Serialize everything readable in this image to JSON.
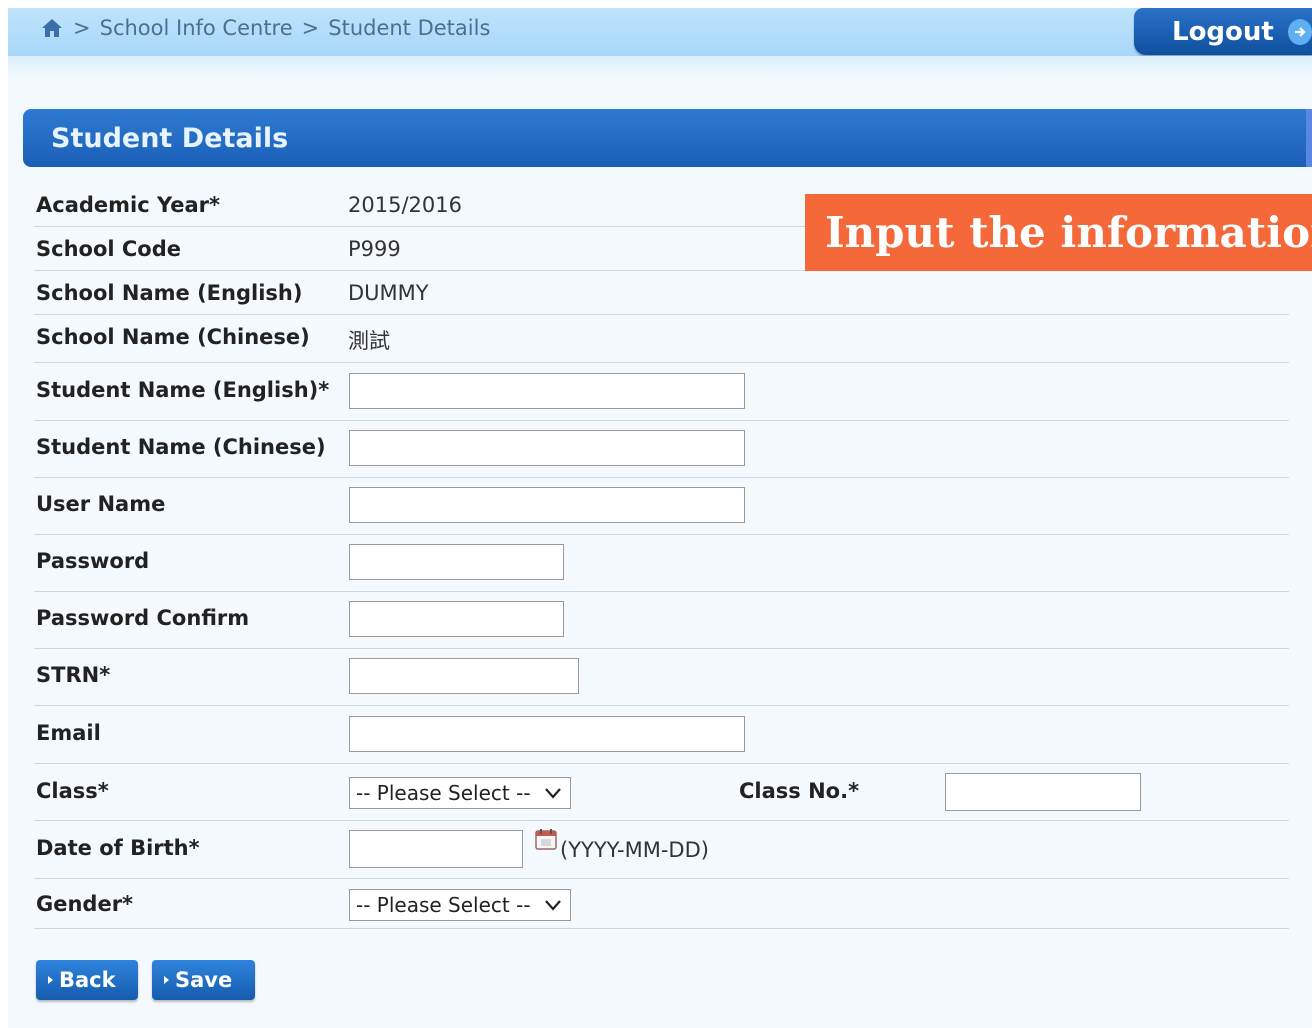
{
  "breadcrumb": {
    "home_icon": "home-icon",
    "items": [
      "School Info Centre",
      "Student Details"
    ],
    "separator": ">"
  },
  "logout": {
    "label": "Logout",
    "icon": "arrow-right-circle-icon"
  },
  "section": {
    "title": "Student Details"
  },
  "banner": {
    "text": "Input the information o"
  },
  "fields": {
    "academic_year": {
      "label": "Academic Year*",
      "value": "2015/2016"
    },
    "school_code": {
      "label": "School Code",
      "value": "P999"
    },
    "school_name_en": {
      "label": "School Name (English)",
      "value": "DUMMY"
    },
    "school_name_zh": {
      "label": "School Name (Chinese)",
      "value": "測試"
    },
    "student_name_en": {
      "label": "Student Name (English)*",
      "value": ""
    },
    "student_name_zh": {
      "label": "Student Name (Chinese)",
      "value": ""
    },
    "user_name": {
      "label": "User Name",
      "value": ""
    },
    "password": {
      "label": "Password",
      "value": ""
    },
    "password_confirm": {
      "label": "Password Confirm",
      "value": ""
    },
    "strn": {
      "label": "STRN*",
      "value": ""
    },
    "email": {
      "label": "Email",
      "value": ""
    },
    "class": {
      "label": "Class*",
      "selected": "-- Please Select --"
    },
    "class_no": {
      "label": "Class No.*",
      "value": ""
    },
    "dob": {
      "label": "Date of Birth*",
      "value": "",
      "format_hint": "(YYYY-MM-DD)",
      "icon": "calendar-icon"
    },
    "gender": {
      "label": "Gender*",
      "selected": "-- Please Select --"
    }
  },
  "buttons": {
    "back": "Back",
    "save": "Save"
  },
  "colors": {
    "topbar": "#a8d8f8",
    "header": "#1a5fb8",
    "button": "#155cae",
    "banner": "#f4683a",
    "link_text": "#4d6f93"
  }
}
